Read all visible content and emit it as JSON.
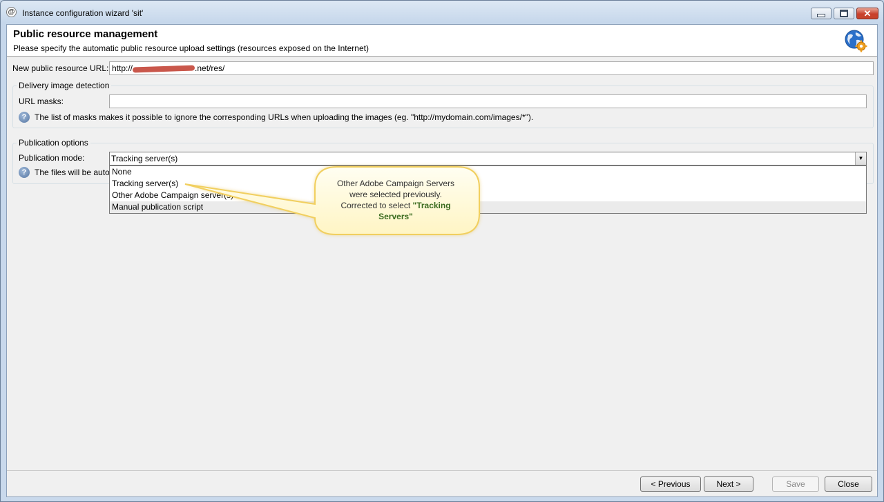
{
  "window": {
    "title": "Instance configuration wizard 'sit'",
    "app_icon": "adobe-campaign-icon",
    "controls": {
      "minimize": "minimize-icon",
      "maximize": "maximize-icon",
      "close": "close-icon"
    }
  },
  "header": {
    "title": "Public resource management",
    "subtitle": "Please specify the automatic public resource upload settings (resources exposed on the Internet)",
    "icon": "globe-gear-icon"
  },
  "url_field": {
    "label": "New public resource URL:",
    "value_prefix": "http://",
    "value_suffix": ".net/res/"
  },
  "delivery_image_detection": {
    "legend": "Delivery image detection",
    "masks_label": "URL masks:",
    "masks_value": "",
    "help_text": "The list of masks makes it possible to ignore the corresponding URLs when uploading the images (eg. \"http://mydomain.com/images/*\")."
  },
  "publication_options": {
    "legend": "Publication options",
    "mode_label": "Publication mode:",
    "selected": "Tracking server(s)",
    "options": [
      "None",
      "Tracking server(s)",
      "Other Adobe Campaign server(s)",
      "Manual publication script"
    ],
    "help_text_partial": "The files will be auto"
  },
  "callout": {
    "line1": "Other Adobe Campaign Servers",
    "line2": "were selected previously.",
    "line3_prefix": "Corrected to select ",
    "line3_quote": "\"",
    "line3_highlight": "Tracking",
    "line4_highlight": "Servers",
    "line4_quote": "\"",
    "highlight_color": "#3a6b1f"
  },
  "buttons": {
    "previous": "< Previous",
    "next": "Next >",
    "save": "Save",
    "close": "Close"
  },
  "colors": {
    "title_bar": "#c6d7eb",
    "close_button": "#c8402c",
    "callout_fill": "#fffbd8"
  }
}
